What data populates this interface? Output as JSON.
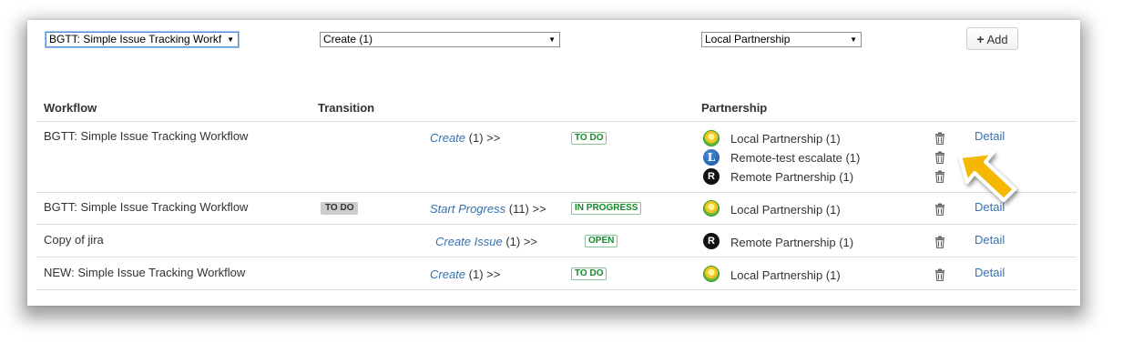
{
  "filters": {
    "workflow_value": "BGTT: Simple Issue Tracking Workf",
    "transition_value": "Create (1)",
    "partnership_value": "Local Partnership",
    "add_label": "Add"
  },
  "table": {
    "headers": {
      "workflow": "Workflow",
      "transition": "Transition",
      "partnership": "Partnership"
    },
    "rows": [
      {
        "workflow": "BGTT: Simple Issue Tracking Workflow",
        "from_status": "",
        "transition": "Create",
        "count": "(1) >>",
        "to_status": "TO DO",
        "partnerships": [
          {
            "icon": "local-partnership-icon",
            "name": "Local Partnership (1)"
          },
          {
            "icon": "remote-l-icon",
            "name": "Remote-test escalate (1)"
          },
          {
            "icon": "remote-r-icon",
            "name": "Remote Partnership (1)"
          }
        ],
        "detail": "Detail"
      },
      {
        "workflow": "BGTT: Simple Issue Tracking Workflow",
        "from_status": "TO DO",
        "transition": "Start Progress",
        "count": "(11) >>",
        "to_status": "IN PROGRESS",
        "partnerships": [
          {
            "icon": "local-partnership-icon",
            "name": "Local Partnership (1)"
          }
        ],
        "detail": "Detail"
      },
      {
        "workflow": "Copy of jira",
        "from_status": "",
        "transition": "Create Issue",
        "count": "(1) >>",
        "to_status": "OPEN",
        "partnerships": [
          {
            "icon": "remote-r-icon",
            "name": "Remote Partnership (1)"
          }
        ],
        "detail": "Detail"
      },
      {
        "workflow": "NEW: Simple Issue Tracking Workflow",
        "from_status": "",
        "transition": "Create",
        "count": "(1) >>",
        "to_status": "TO DO",
        "partnerships": [
          {
            "icon": "local-partnership-icon",
            "name": "Local Partnership (1)"
          }
        ],
        "detail": "Detail"
      }
    ]
  },
  "icon_glyphs": {
    "remote_l": "L",
    "remote_r": "R"
  },
  "colors": {
    "link": "#3572b0",
    "status_green": "#14892c",
    "callout_arrow": "#f5b800"
  }
}
